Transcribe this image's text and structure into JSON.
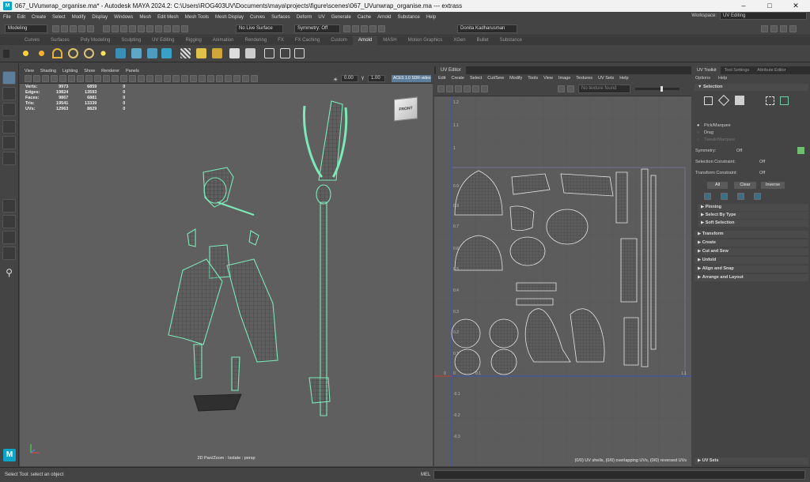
{
  "window": {
    "title": "067_UVunwrap_organise.ma* - Autodesk MAYA 2024.2: C:\\Users\\ROG403UV\\Documents\\maya\\projects\\figure\\scenes\\067_UVunwrap_organise.ma   ---   extrass",
    "app_icon": "M",
    "controls": [
      "minimize-icon",
      "maximize-icon",
      "close-icon"
    ]
  },
  "menubar": {
    "items": [
      "File",
      "Edit",
      "Create",
      "Select",
      "Modify",
      "Display",
      "Windows",
      "Mesh",
      "Edit Mesh",
      "Mesh Tools",
      "Mesh Display",
      "Curves",
      "Surfaces",
      "Deform",
      "UV",
      "Generate",
      "Cache",
      "Arnold",
      "Substance",
      "Help"
    ],
    "workspace_label": "Workspace:",
    "workspace_value": "UV Editing"
  },
  "statusline": {
    "mode": "Modeling",
    "live_surface": "No Live Surface",
    "symmetry": "Symmetry: Off",
    "user": "Donita Kadharusman"
  },
  "shelf": {
    "tabs": [
      "Curves",
      "Surfaces",
      "Poly Modeling",
      "Sculpting",
      "UV Editing",
      "Rigging",
      "Animation",
      "Rendering",
      "FX",
      "FX Caching",
      "Custom",
      "Arnold",
      "MASH",
      "Motion Graphics",
      "XGen",
      "Bullet",
      "Substance"
    ],
    "active_tab": "Arnold"
  },
  "viewport": {
    "menu": [
      "View",
      "Shading",
      "Lighting",
      "Show",
      "Renderer",
      "Panels"
    ],
    "exposure": "0.00",
    "gamma": "1.00",
    "color_space": "ACES 1.0 SDR-video",
    "hud": {
      "rows": [
        {
          "label": "Verts:",
          "a": "9973",
          "b": "6859",
          "c": "0"
        },
        {
          "label": "Edges:",
          "a": "19824",
          "b": "13593",
          "c": "0"
        },
        {
          "label": "Faces:",
          "a": "9867",
          "b": "6881",
          "c": "0"
        },
        {
          "label": "Tris:",
          "a": "19541",
          "b": "13339",
          "c": "0"
        },
        {
          "label": "UVs:",
          "a": "12963",
          "b": "8829",
          "c": "0"
        }
      ]
    },
    "view_cube": "FRONT",
    "footer": "2D Pan/Zoom : Isolate : persp",
    "wire_color": "#7de8b8"
  },
  "uv_editor": {
    "tab": "UV Editor",
    "menu": [
      "Edit",
      "Create",
      "Select",
      "Cut/Sew",
      "Modify",
      "Tools",
      "View",
      "Image",
      "Textures",
      "UV Sets",
      "Help"
    ],
    "texture_field": "No texture found",
    "axis_labels": {
      "v_axis": [
        "1.2",
        "1.1",
        "1",
        "0.9",
        "0.8",
        "0.7",
        "0.6",
        "0.5",
        "0.4",
        "0.3",
        "0.2",
        "0.1",
        "0",
        "-0.1",
        "-0.2",
        "-0.3"
      ],
      "u_axis": [
        "0",
        "0.1",
        "1.1"
      ]
    },
    "footer": "(0/0) UV shells, (0/0) overlapping UVs, (0/0) reversed UVs"
  },
  "toolkit": {
    "tabs": [
      "UV Toolkit",
      "Tool Settings",
      "Attribute Editor"
    ],
    "active_tab": "UV Toolkit",
    "menu": [
      "Options",
      "Help"
    ],
    "selection_header": "Selection",
    "pick_modes": [
      "Pick/Marquee",
      "Drag",
      "Tweak/Marquee"
    ],
    "symmetry_label": "Symmetry:",
    "symmetry_value": "Off",
    "selection_constraint_label": "Selection Constraint:",
    "selection_constraint_value": "Off",
    "transform_constraint_label": "Transform Constraint:",
    "transform_constraint_value": "Off",
    "buttons": [
      "All",
      "Clear",
      "Inverse"
    ],
    "subsections": [
      "Pinning",
      "Select By Type",
      "Soft Selection"
    ],
    "sections": [
      "Transform",
      "Create",
      "Cut and Sew",
      "Unfold",
      "Align and Snap",
      "Arrange and Layout"
    ],
    "footer_section": "UV Sets"
  },
  "commandline": {
    "help": "Select Tool: select an object",
    "lang": "MEL"
  }
}
